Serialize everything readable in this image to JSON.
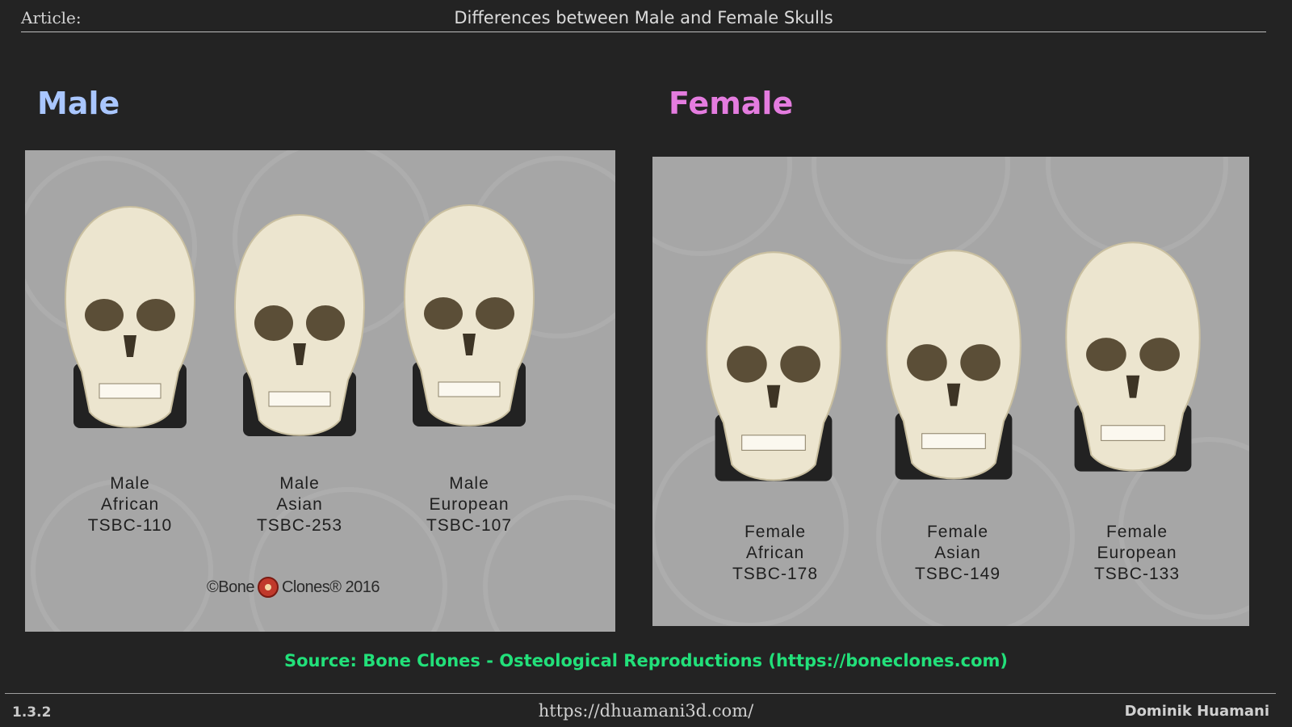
{
  "header": {
    "label": "Article:",
    "title": "Differences between Male and Female Skulls"
  },
  "male": {
    "title": "Male",
    "skulls": [
      {
        "line1": "Male",
        "line2": "African",
        "line3": "TSBC-110"
      },
      {
        "line1": "Male",
        "line2": "Asian",
        "line3": "TSBC-253"
      },
      {
        "line1": "Male",
        "line2": "European",
        "line3": "TSBC-107"
      }
    ],
    "copyright_pre": "©Bone",
    "copyright_post": "Clones® 2016"
  },
  "female": {
    "title": "Female",
    "skulls": [
      {
        "line1": "Female",
        "line2": "African",
        "line3": "TSBC-178"
      },
      {
        "line1": "Female",
        "line2": "Asian",
        "line3": "TSBC-149"
      },
      {
        "line1": "Female",
        "line2": "European",
        "line3": "TSBC-133"
      }
    ]
  },
  "source": "Source: Bone Clones - Osteological Reproductions (https://boneclones.com)",
  "footer": {
    "section": "1.3.2",
    "url": "https://dhuamani3d.com/",
    "author": "Dominik Huamani"
  },
  "colors": {
    "background": "#232323",
    "male_title": "#a9c6ff",
    "female_title": "#e47cdf",
    "source": "#22e07a",
    "photo_background": "#a6a6a6",
    "bone": "#ece5cf"
  },
  "icons": [
    "skull-icon",
    "bone-clones-logo-icon"
  ]
}
